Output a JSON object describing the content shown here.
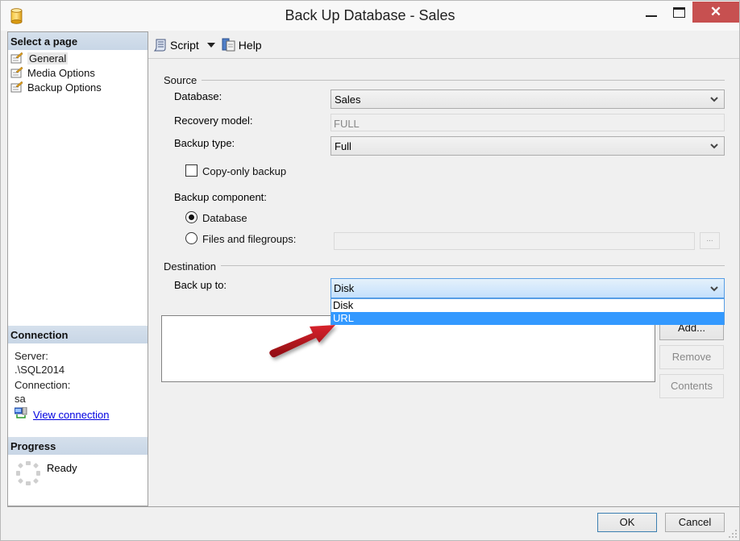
{
  "window": {
    "title": "Back Up Database - Sales",
    "icons": {
      "app": "database-cylinder-icon",
      "minimize": "minimize-icon",
      "maximize": "maximize-icon",
      "close": "close-icon"
    },
    "close_glyph": "✕"
  },
  "left_panel": {
    "select_page_header": "Select a page",
    "pages": [
      {
        "label": "General",
        "icon": "page-properties-icon",
        "selected": true
      },
      {
        "label": "Media Options",
        "icon": "page-properties-icon",
        "selected": false
      },
      {
        "label": "Backup Options",
        "icon": "page-properties-icon",
        "selected": false
      }
    ],
    "connection_header": "Connection",
    "server_label": "Server:",
    "server_value": ".\\SQL2014",
    "connection_label": "Connection:",
    "connection_value": "sa",
    "view_connection_link": "View connection",
    "progress_header": "Progress",
    "progress_status": "Ready"
  },
  "toolbar": {
    "script_label": "Script",
    "help_label": "Help"
  },
  "source": {
    "group_title": "Source",
    "database_label": "Database:",
    "database_value": "Sales",
    "recovery_model_label": "Recovery model:",
    "recovery_model_value": "FULL",
    "backup_type_label": "Backup type:",
    "backup_type_value": "Full",
    "copy_only_label": "Copy-only backup",
    "copy_only_checked": false,
    "backup_component_label": "Backup component:",
    "component_options": [
      {
        "label": "Database",
        "checked": true
      },
      {
        "label": "Files and filegroups:",
        "checked": false
      }
    ],
    "filegroups_value": "",
    "ellipsis_label": "..."
  },
  "destination": {
    "group_title": "Destination",
    "back_up_to_label": "Back up to:",
    "back_up_to_value": "Disk",
    "dropdown_options": [
      {
        "label": "Disk",
        "highlighted": false
      },
      {
        "label": "URL",
        "highlighted": true
      }
    ],
    "destinations": [],
    "add_button": "Add...",
    "remove_button": "Remove",
    "contents_button": "Contents"
  },
  "footer": {
    "ok_button": "OK",
    "cancel_button": "Cancel"
  },
  "colors": {
    "close_red": "#c75050",
    "highlight_blue": "#3399ff",
    "header_blue": "#d5e0ec",
    "link_blue": "#0000e0",
    "annotation_arrow": "#b5121b"
  }
}
